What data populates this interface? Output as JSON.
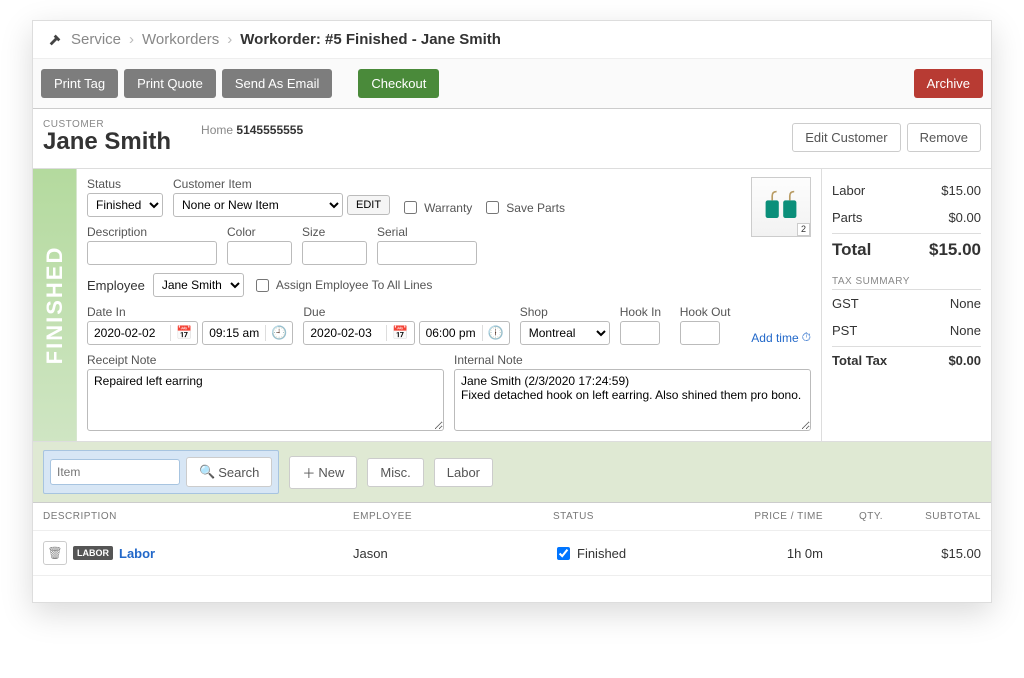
{
  "breadcrumb": {
    "a": "Service",
    "b": "Workorders",
    "current": "Workorder: #5 Finished - Jane Smith"
  },
  "toolbar": {
    "print_tag": "Print Tag",
    "print_quote": "Print Quote",
    "send_email": "Send As Email",
    "checkout": "Checkout",
    "archive": "Archive"
  },
  "customer": {
    "label": "CUSTOMER",
    "name": "Jane Smith",
    "phone_label": "Home",
    "phone": "5145555555",
    "edit": "Edit Customer",
    "remove": "Remove"
  },
  "status_band": "FINISHED",
  "form": {
    "status_label": "Status",
    "status_value": "Finished",
    "custitem_label": "Customer Item",
    "custitem_value": "None or New Item",
    "edit_btn": "EDIT",
    "warranty": "Warranty",
    "save_parts": "Save Parts",
    "description_label": "Description",
    "color_label": "Color",
    "size_label": "Size",
    "serial_label": "Serial",
    "employee_label": "Employee",
    "employee_value": "Jane Smith",
    "assign_all": "Assign Employee To All Lines",
    "date_in_label": "Date In",
    "date_in": "2020-02-02",
    "time_in": "09:15 am",
    "due_label": "Due",
    "due_date": "2020-02-03",
    "due_time": "06:00 pm",
    "shop_label": "Shop",
    "shop_value": "Montreal",
    "hook_in_label": "Hook In",
    "hook_out_label": "Hook Out",
    "receipt_note_label": "Receipt Note",
    "receipt_note": "Repaired left earring",
    "internal_note_label": "Internal Note",
    "internal_note": "Jane Smith (2/3/2020 17:24:59)\nFixed detached hook on left earring. Also shined them pro bono.",
    "add_time": "Add time"
  },
  "totals": {
    "labor_label": "Labor",
    "labor": "$15.00",
    "parts_label": "Parts",
    "parts": "$0.00",
    "total_label": "Total",
    "total": "$15.00",
    "tax_summary": "TAX SUMMARY",
    "gst_label": "GST",
    "gst": "None",
    "pst_label": "PST",
    "pst": "None",
    "total_tax_label": "Total Tax",
    "total_tax": "$0.00"
  },
  "line_add": {
    "item_placeholder": "Item",
    "search": "Search",
    "new": "New",
    "misc": "Misc.",
    "labor": "Labor"
  },
  "thead": {
    "description": "DESCRIPTION",
    "employee": "EMPLOYEE",
    "status": "STATUS",
    "price": "PRICE / TIME",
    "qty": "QTY.",
    "subtotal": "SUBTOTAL"
  },
  "lines": {
    "0": {
      "tag": "LABOR",
      "desc": "Labor",
      "employee": "Jason",
      "status": "Finished",
      "price": "1h 0m",
      "qty": "",
      "subtotal": "$15.00"
    }
  }
}
